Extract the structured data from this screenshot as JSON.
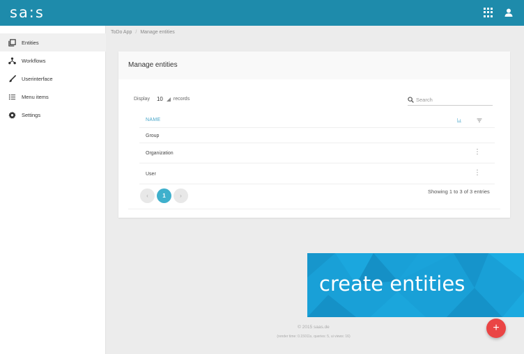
{
  "app": {
    "logo": "sa:s"
  },
  "topbar": {
    "apps_icon": "apps-grid-icon",
    "user_icon": "user-icon"
  },
  "sidebar": {
    "items": [
      {
        "label": "Entities",
        "icon": "entities-icon",
        "active": true
      },
      {
        "label": "Workflows",
        "icon": "workflow-icon",
        "active": false
      },
      {
        "label": "Userinterface",
        "icon": "brush-icon",
        "active": false
      },
      {
        "label": "Menu items",
        "icon": "list-icon",
        "active": false
      },
      {
        "label": "Settings",
        "icon": "gear-icon",
        "active": false
      }
    ]
  },
  "breadcrumb": {
    "root": "ToDo App",
    "current": "Manage entities"
  },
  "card": {
    "title": "Manage entities",
    "display_label": "Display",
    "display_value": "10",
    "records_label": "records",
    "search_placeholder": "Search",
    "table": {
      "header": "NAME",
      "rows": [
        "Group",
        "Organization",
        "User"
      ]
    },
    "pagination": {
      "prev": "‹",
      "current": "1",
      "next": "›"
    },
    "showing": "Showing 1 to 3 of 3 entries"
  },
  "banner": {
    "text": "create entities"
  },
  "footer": {
    "copyright": "© 2015 saas.de",
    "render_info": "(render time: 0.15011s, queries: 5, ui views: 16)"
  },
  "fab": {
    "label": "+"
  },
  "colors": {
    "topbar": "#1e8bab",
    "accent": "#3fb0cc",
    "banner": "#19a0d7",
    "fab": "#ea4545"
  }
}
